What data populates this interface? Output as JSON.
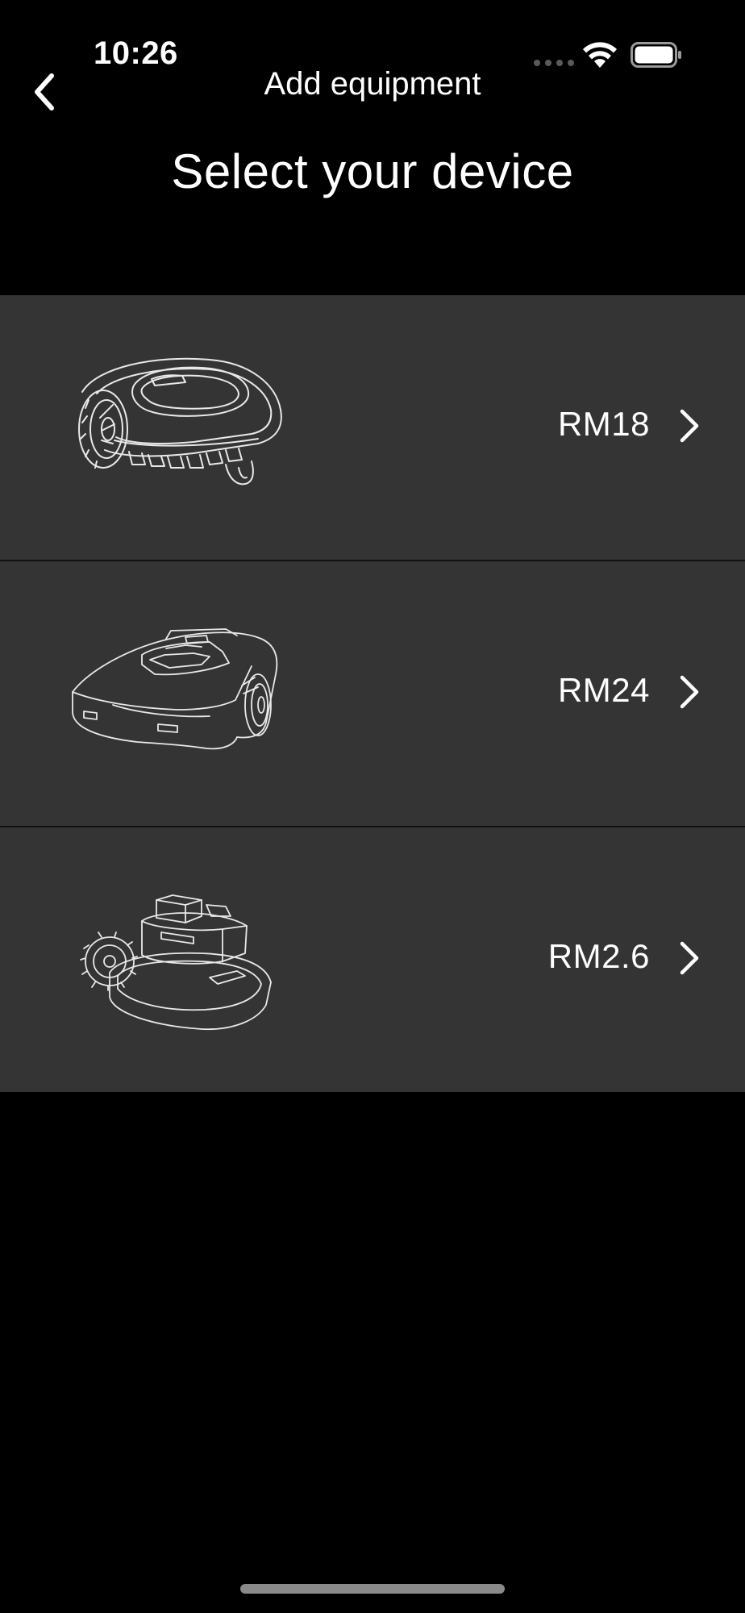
{
  "status_bar": {
    "time": "10:26",
    "icons": [
      "signal-dots-icon",
      "wifi-icon",
      "battery-icon"
    ]
  },
  "nav": {
    "back_icon": "chevron-left-icon",
    "title": "Add equipment"
  },
  "page": {
    "title": "Select your device"
  },
  "devices": [
    {
      "name": "RM18",
      "icon": "robot-mower-rm18-illustration"
    },
    {
      "name": "RM24",
      "icon": "robot-mower-rm24-illustration"
    },
    {
      "name": "RM2.6",
      "icon": "robot-mower-rm26-illustration"
    }
  ],
  "colors": {
    "background": "#000000",
    "row_background": "#343434",
    "text": "#ffffff"
  }
}
